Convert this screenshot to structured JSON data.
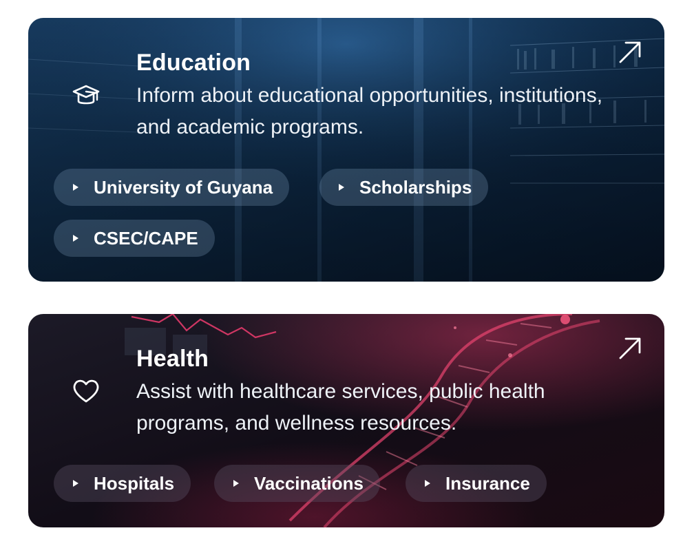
{
  "cards": [
    {
      "title": "Education",
      "description": "Inform about educational opportunities, institutions, and academic programs.",
      "icon": "graduation-cap-icon",
      "tags": [
        "University of Guyana",
        "Scholarships",
        "CSEC/CAPE"
      ]
    },
    {
      "title": "Health",
      "description": "Assist with healthcare services, public health programs, and wellness resources.",
      "icon": "heart-icon",
      "tags": [
        "Hospitals",
        "Vaccinations",
        "Insurance"
      ]
    }
  ],
  "colors": {
    "education_bg": "#0f2c4c",
    "health_bg": "#140d18",
    "health_accent": "#e23a6a",
    "text": "#ffffff"
  }
}
